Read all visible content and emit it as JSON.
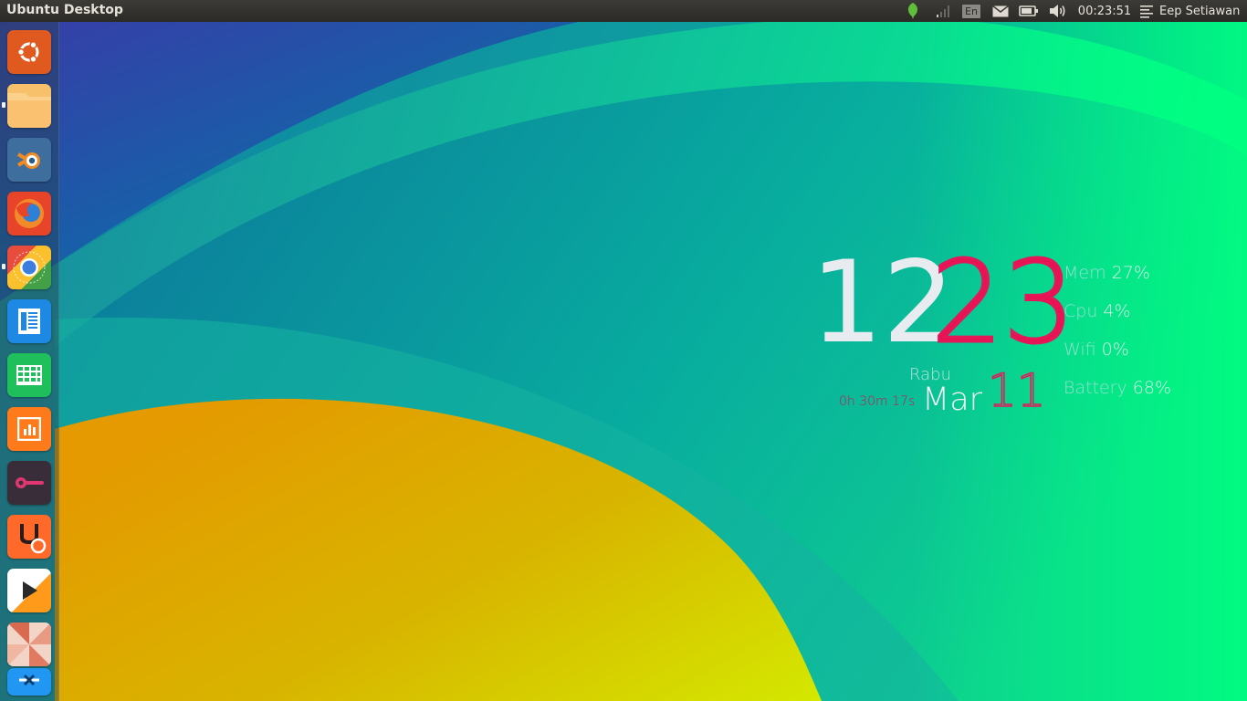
{
  "panel": {
    "title": "Ubuntu Desktop",
    "language": "En",
    "clock": "00:23:51",
    "user": "Eep Setiawan"
  },
  "launcher": {
    "items": [
      {
        "name": "dash-home",
        "icon": "ubuntu-logo-icon",
        "color": "#e95420",
        "running": false
      },
      {
        "name": "files",
        "icon": "folder-icon",
        "color": "#f5a623",
        "running": true
      },
      {
        "name": "blender",
        "icon": "blender-icon",
        "color": "#4a7fb0",
        "running": false
      },
      {
        "name": "firefox",
        "icon": "firefox-icon",
        "color": "#f0562a",
        "running": false
      },
      {
        "name": "chrome",
        "icon": "chrome-icon",
        "color": "#fbc02d",
        "running": true
      },
      {
        "name": "writer",
        "icon": "text-document-icon",
        "color": "#1e88e5",
        "running": false
      },
      {
        "name": "calc",
        "icon": "spreadsheet-icon",
        "color": "#2ecc71",
        "running": false
      },
      {
        "name": "impress",
        "icon": "presentation-icon",
        "color": "#ff7a1a",
        "running": false
      },
      {
        "name": "settings",
        "icon": "toggle-switch-icon",
        "color": "#3a2d3a",
        "running": false
      },
      {
        "name": "software-center",
        "icon": "software-bag-icon",
        "color": "#ff6a2b",
        "running": false
      },
      {
        "name": "media-player",
        "icon": "play-icon",
        "color": "#ff9a1a",
        "running": false
      },
      {
        "name": "system-tool",
        "icon": "pinwheel-icon",
        "color": "#e57a5d",
        "running": false
      },
      {
        "name": "trash",
        "icon": "trash-icon",
        "color": "#2196f3",
        "running": false
      }
    ]
  },
  "conky": {
    "hour": "12",
    "minute": "23",
    "day_name": "Rabu",
    "month": "Mar",
    "day": "11",
    "uptime": "0h 30m 17s",
    "stats": [
      {
        "label": "Mem",
        "value": "27%"
      },
      {
        "label": "Cpu",
        "value": "4%"
      },
      {
        "label": "Wifi",
        "value": "0%"
      },
      {
        "label": "Battery",
        "value": "68%"
      }
    ]
  },
  "colors": {
    "accent_red": "#e3175a",
    "panel_bg": "#3c3b37",
    "wallpaper_green": "#00ff88",
    "wallpaper_yellow": "#d9e000"
  }
}
